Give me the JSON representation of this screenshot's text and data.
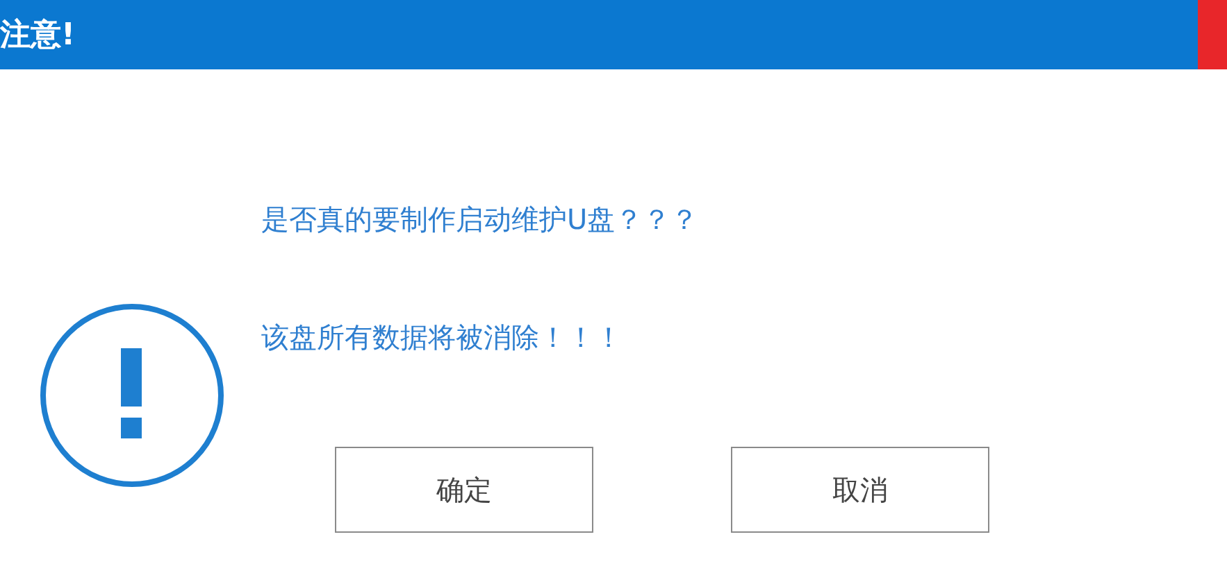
{
  "window": {
    "title": "注意!"
  },
  "messages": [
    "是否真的要制作启动维护U盘？？？",
    "该盘所有数据将被消除！！！"
  ],
  "buttons": [
    "确定",
    "取消"
  ]
}
